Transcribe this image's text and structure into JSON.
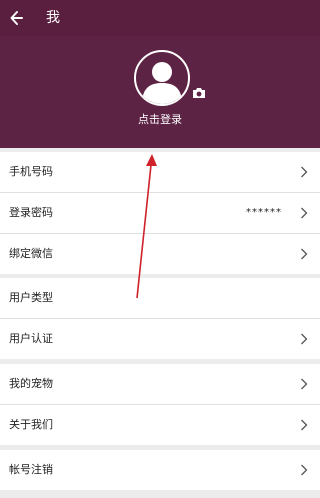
{
  "header": {
    "title": "我"
  },
  "profile": {
    "login_label": "点击登录"
  },
  "menu": [
    {
      "label": "手机号码",
      "value": "",
      "chevron": true
    },
    {
      "label": "登录密码",
      "value": "******",
      "chevron": true
    },
    {
      "label": "绑定微信",
      "value": "",
      "chevron": true
    },
    {
      "label": "用户类型",
      "value": "",
      "chevron": false
    },
    {
      "label": "用户认证",
      "value": "",
      "chevron": true
    },
    {
      "label": "我的宠物",
      "value": "",
      "chevron": true
    },
    {
      "label": "关于我们",
      "value": "",
      "chevron": true
    },
    {
      "label": "帐号注销",
      "value": "",
      "chevron": true
    }
  ],
  "colors": {
    "topbar": "#5a1e3f",
    "header": "#5d2344",
    "annotation_arrow": "#d0222a"
  },
  "icons": {
    "back": "arrow-left-icon",
    "avatar": "person-icon",
    "camera": "camera-icon",
    "row": "chevron-right-icon"
  }
}
